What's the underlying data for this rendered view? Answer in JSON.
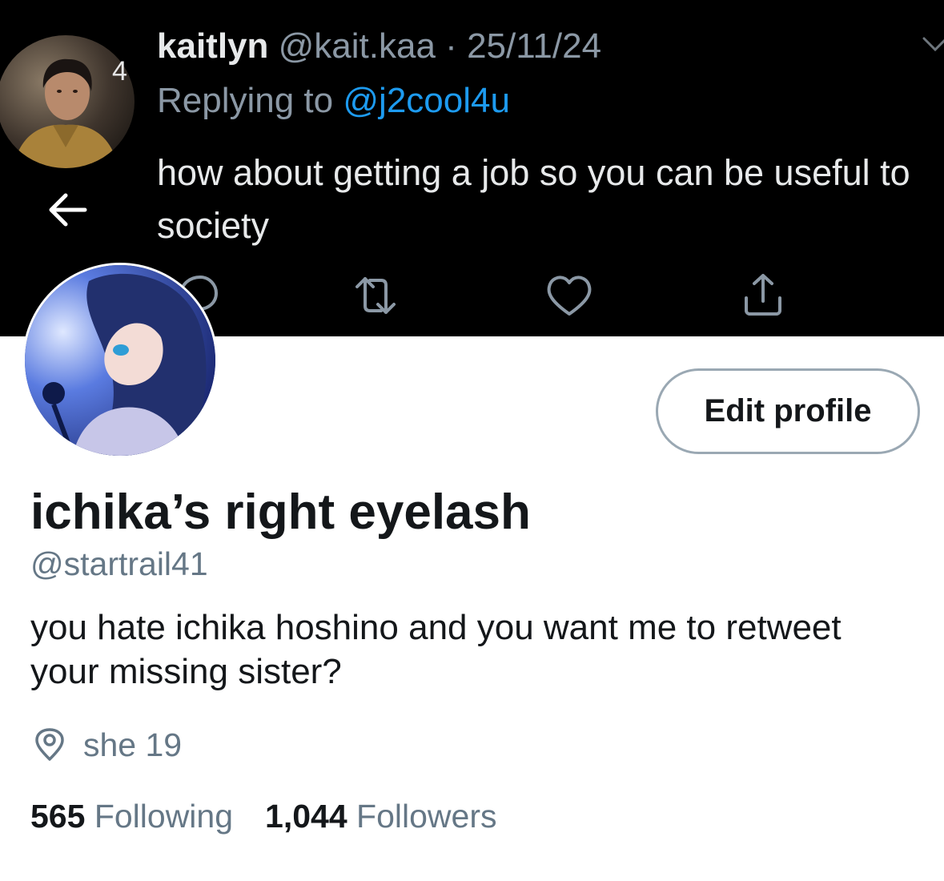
{
  "header_tweet": {
    "stray_digit": "4",
    "author_name": "kaitlyn",
    "author_handle": "@kait.kaa",
    "separator": "·",
    "date": "25/11/24",
    "replying_prefix": "Replying to",
    "replying_to": "@j2cool4u",
    "text": "how about getting a job so you can be useful to society",
    "icons": [
      "chevron-down-icon",
      "back-arrow-icon",
      "reply-icon",
      "retweet-icon",
      "like-icon",
      "share-icon"
    ]
  },
  "profile": {
    "display_name": "ichika’s right eyelash",
    "handle": "@startrail41",
    "bio": "you hate ichika hoshino and you want me to retweet your missing sister?",
    "location": "she 19",
    "edit_button_label": "Edit profile",
    "following_count": "565",
    "following_label": "Following",
    "followers_count": "1,044",
    "followers_label": "Followers"
  },
  "colors": {
    "banner_bg": "#000000",
    "mention_blue": "#1d9bf0",
    "secondary_text": "#657786",
    "primary_text": "#14171a"
  }
}
